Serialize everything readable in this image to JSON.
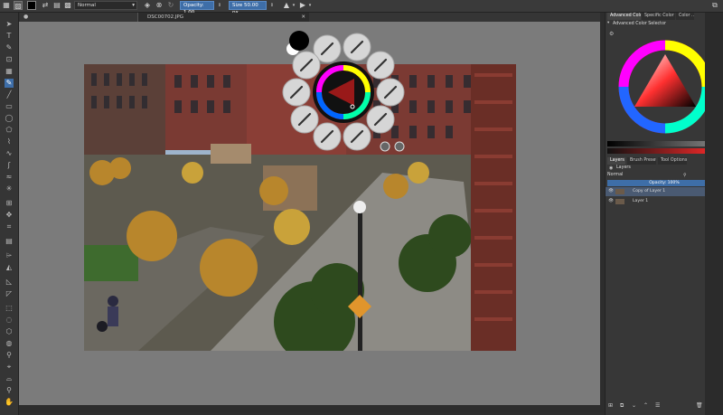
{
  "toolbar": {
    "blend_mode": "Normal",
    "opacity_label": "Opacity:",
    "opacity_value": "1.00",
    "size_label": "Size",
    "size_value": "50.00 px"
  },
  "document": {
    "tab_title": "DSC00702.JPG"
  },
  "docker": {
    "tabs": [
      "Advanced Color S...",
      "Specific Color S...",
      "Color ..."
    ],
    "color_panel_title": "Advanced Color Selector",
    "layer_tabs": [
      "Layers",
      "Brush Presets",
      "Tool Options"
    ],
    "layers_panel_title": "Layers",
    "blend_mode": "Normal",
    "opacity_text": "Opacity: 100%",
    "layers": [
      {
        "name": "Copy of Layer 1"
      },
      {
        "name": "Layer 1"
      }
    ]
  },
  "palette": {
    "foreground_color": "#000000",
    "background_color": "#ffffff"
  },
  "colors": {
    "accent": "#3e6ea8",
    "canvas_bg": "#7b7b7b",
    "ui_bg": "#353535"
  }
}
